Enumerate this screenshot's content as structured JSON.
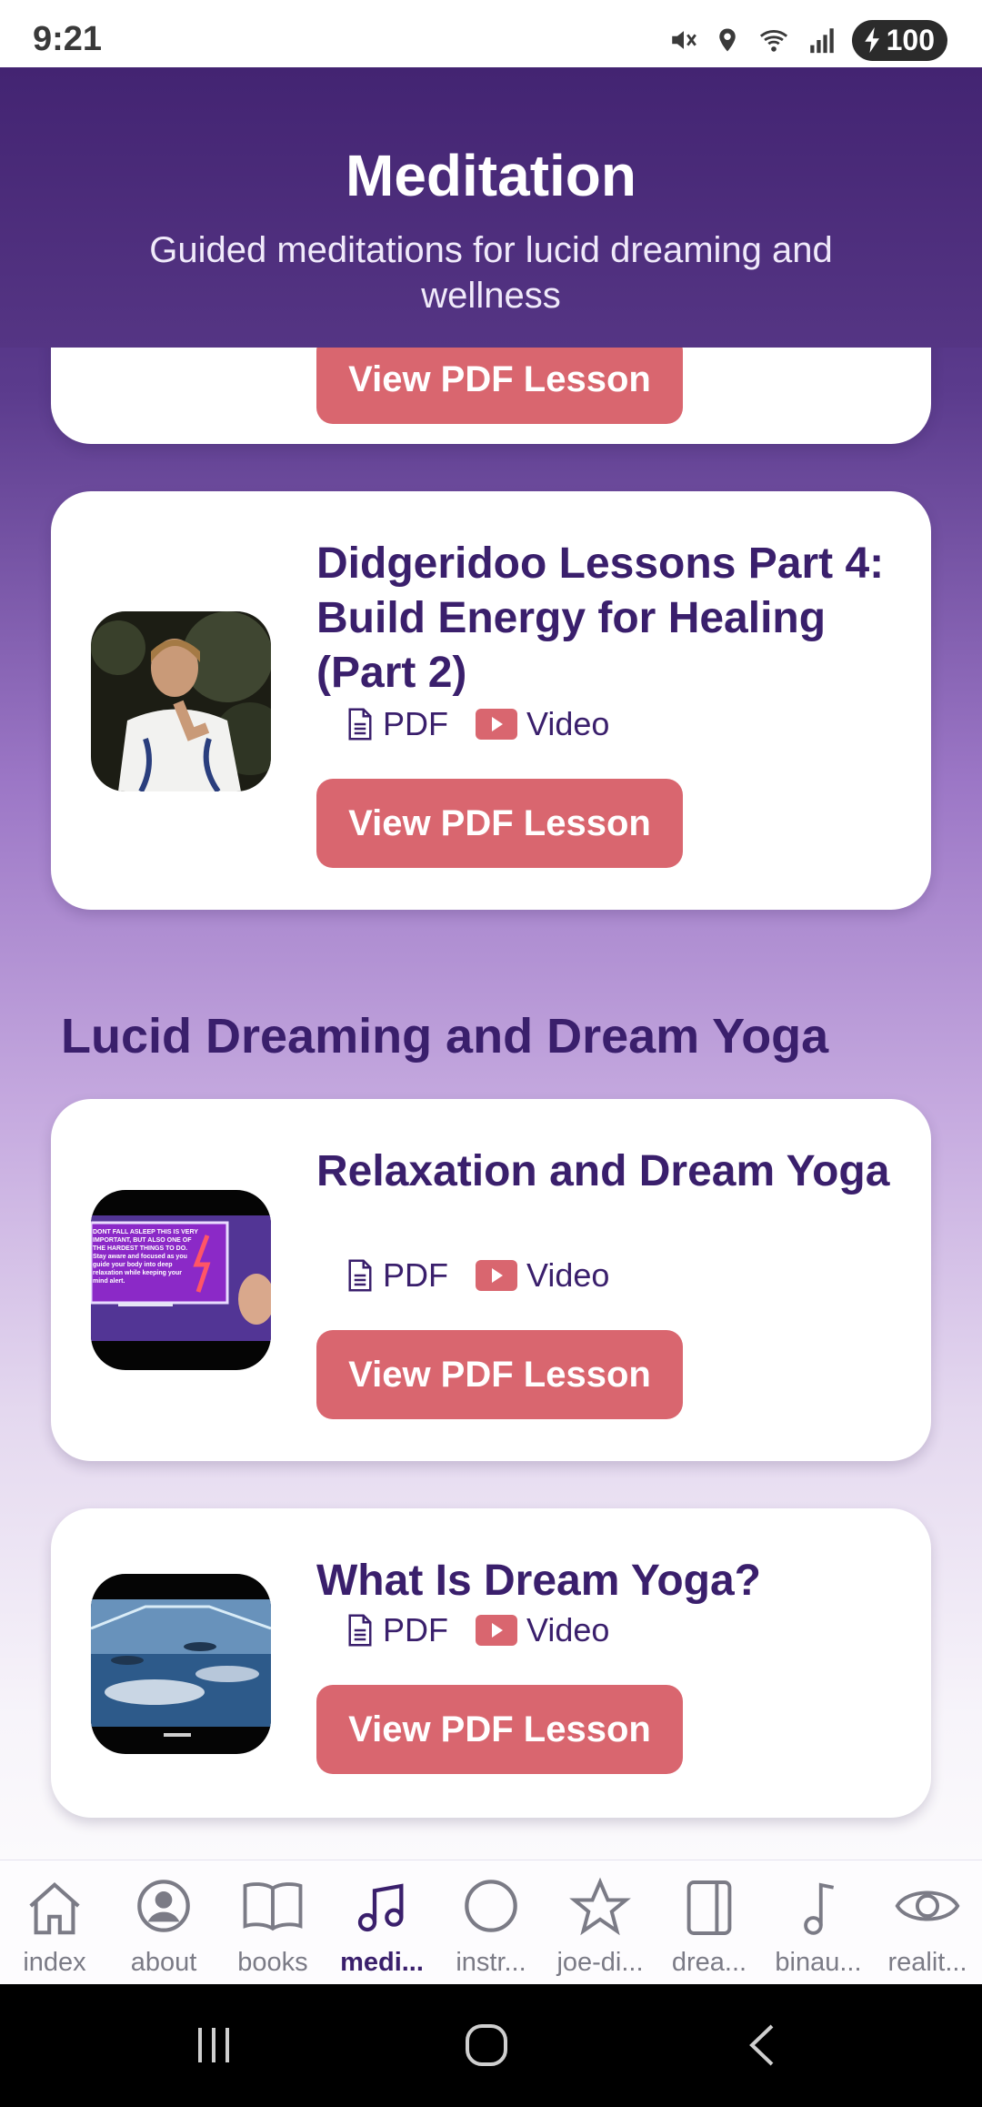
{
  "status_bar": {
    "time": "9:21",
    "battery": "100"
  },
  "header": {
    "title": "Meditation",
    "subtitle": "Guided meditations for lucid dreaming and wellness"
  },
  "cards": [
    {
      "button": "View PDF Lesson"
    },
    {
      "title": "Didgeridoo Lessons Part 4: Build Energy for Healing (Part 2)",
      "pdf_label": "PDF",
      "video_label": "Video",
      "button": "View PDF Lesson"
    },
    {
      "title": "Relaxation and Dream Yoga",
      "pdf_label": "PDF",
      "video_label": "Video",
      "button": "View PDF Lesson",
      "thumb_text": "DONT FALL ASLEEP THIS IS VERY IMPORTANT, BUT ALSO ONE OF THE HARDEST THINGS TO DO. Stay aware and focused as you guide your body into deep relaxation while keeping your mind alert."
    },
    {
      "title": "What Is Dream Yoga?",
      "pdf_label": "PDF",
      "video_label": "Video",
      "button": "View PDF Lesson"
    }
  ],
  "section": {
    "title": "Lucid Dreaming and Dream Yoga"
  },
  "nav": {
    "items": [
      {
        "label": "index",
        "icon": "home-icon"
      },
      {
        "label": "about",
        "icon": "user-circle-icon"
      },
      {
        "label": "books",
        "icon": "book-icon"
      },
      {
        "label": "medi...",
        "icon": "music-note-icon",
        "active": true
      },
      {
        "label": "instr...",
        "icon": "circle-icon"
      },
      {
        "label": "joe-di...",
        "icon": "star-icon"
      },
      {
        "label": "drea...",
        "icon": "tablet-icon"
      },
      {
        "label": "binau...",
        "icon": "music-note-icon"
      },
      {
        "label": "realit...",
        "icon": "eye-icon"
      }
    ]
  },
  "colors": {
    "header": "#432472",
    "accent": "#3a1f6c",
    "button": "#d9666f",
    "video_icon": "#d9666f"
  }
}
